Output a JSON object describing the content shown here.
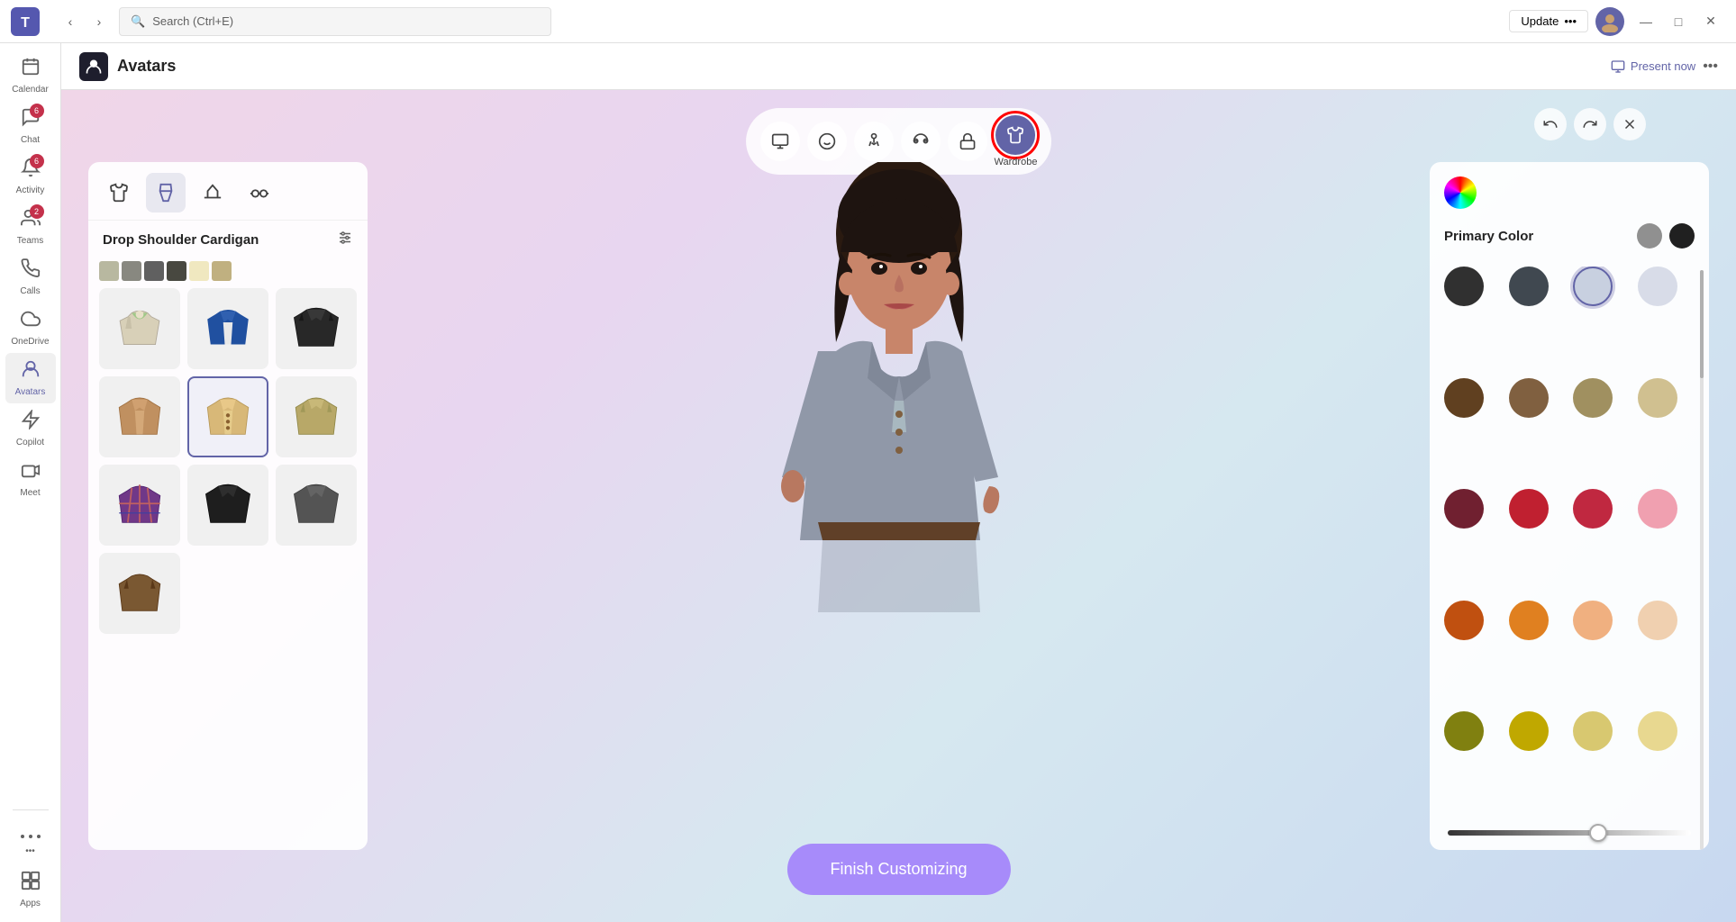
{
  "titlebar": {
    "search_placeholder": "Search (Ctrl+E)",
    "update_label": "Update",
    "update_dots": "•••",
    "minimize": "—",
    "maximize": "□",
    "close": "✕"
  },
  "sidebar": {
    "items": [
      {
        "id": "calendar",
        "label": "Calendar",
        "icon": "📅",
        "badge": null,
        "active": false
      },
      {
        "id": "chat",
        "label": "Chat",
        "icon": "💬",
        "badge": "6",
        "active": false
      },
      {
        "id": "activity",
        "label": "Activity",
        "icon": "🔔",
        "badge": "6",
        "active": false
      },
      {
        "id": "teams",
        "label": "Teams",
        "icon": "👥",
        "badge": "2",
        "active": false
      },
      {
        "id": "calls",
        "label": "Calls",
        "icon": "📞",
        "badge": null,
        "active": false
      },
      {
        "id": "onedrive",
        "label": "OneDrive",
        "icon": "☁",
        "badge": null,
        "active": false
      },
      {
        "id": "avatars",
        "label": "Avatars",
        "icon": "👤",
        "badge": null,
        "active": true
      },
      {
        "id": "copilot",
        "label": "Copilot",
        "icon": "✦",
        "badge": null,
        "active": false
      },
      {
        "id": "meet",
        "label": "Meet",
        "icon": "📹",
        "badge": null,
        "active": false
      },
      {
        "id": "more",
        "label": "•••",
        "icon": "•••",
        "badge": null,
        "active": false
      },
      {
        "id": "apps",
        "label": "Apps",
        "icon": "⊞",
        "badge": null,
        "active": false
      }
    ]
  },
  "appbar": {
    "title": "Avatars",
    "present_label": "Present now",
    "more_label": "•••"
  },
  "toolbar": {
    "buttons": [
      {
        "id": "display",
        "icon": "🖥",
        "label": "",
        "active": false
      },
      {
        "id": "face",
        "icon": "😊",
        "label": "",
        "active": false
      },
      {
        "id": "body",
        "icon": "🧍",
        "label": "",
        "active": false
      },
      {
        "id": "features",
        "icon": "👁",
        "label": "",
        "active": false
      },
      {
        "id": "accessories",
        "icon": "🤲",
        "label": "",
        "active": false
      },
      {
        "id": "wardrobe",
        "icon": "👕",
        "label": "Wardrobe",
        "active": true
      }
    ],
    "undo_label": "↩",
    "redo_label": "↪",
    "close_label": "✕"
  },
  "left_panel": {
    "tabs": [
      {
        "id": "shirt",
        "icon": "👕",
        "active": false
      },
      {
        "id": "pants",
        "icon": "🩲",
        "active": true
      },
      {
        "id": "hat",
        "icon": "🎩",
        "active": false
      },
      {
        "id": "glasses",
        "icon": "👓",
        "active": false
      }
    ],
    "title": "Drop Shoulder Cardigan",
    "filter_icon": "≡",
    "color_swatches": [
      "#b8b8a0",
      "#888880",
      "#606060",
      "#484840",
      "#f0e8c0",
      "#c0b080"
    ],
    "clothing_items": [
      {
        "id": "hoodie",
        "selected": false,
        "color": "#e0d8c0"
      },
      {
        "id": "blazer-blue",
        "selected": false,
        "color": "#2860a0"
      },
      {
        "id": "jacket-black",
        "selected": false,
        "color": "#282828"
      },
      {
        "id": "cardigan-tan",
        "selected": false,
        "color": "#c89860"
      },
      {
        "id": "cardigan-selected",
        "selected": true,
        "color": "#e0c890"
      },
      {
        "id": "jacket-khaki",
        "selected": false,
        "color": "#c0b070"
      },
      {
        "id": "plaid-jacket",
        "selected": false,
        "color": "#705090"
      },
      {
        "id": "blazer-dark",
        "selected": false,
        "color": "#202020"
      },
      {
        "id": "blazer-gray",
        "selected": false,
        "color": "#505050"
      },
      {
        "id": "jacket-brown",
        "selected": false,
        "color": "#7a5030"
      }
    ]
  },
  "right_panel": {
    "primary_color_label": "Primary Color",
    "preset_swatches": [
      {
        "color": "#909090",
        "selected": false
      },
      {
        "color": "#202020",
        "selected": false
      }
    ],
    "color_rows": [
      [
        "#303030",
        "#404850",
        "#c8d0e0",
        "#d8dce8"
      ],
      [
        "#604020",
        "#806040",
        "#a09060",
        "#d0c090"
      ],
      [
        "#702030",
        "#c02030",
        "#c02840",
        "#f0a0b0"
      ],
      [
        "#c05010",
        "#e08020",
        "#f0b080",
        "#f0d0b0"
      ],
      [
        "#808010",
        "#c0a800",
        "#d8c870",
        "#e8d890"
      ]
    ],
    "selected_color": "#c8d0e0",
    "slider_value": 62
  },
  "finish_button": {
    "label": "Finish Customizing"
  }
}
